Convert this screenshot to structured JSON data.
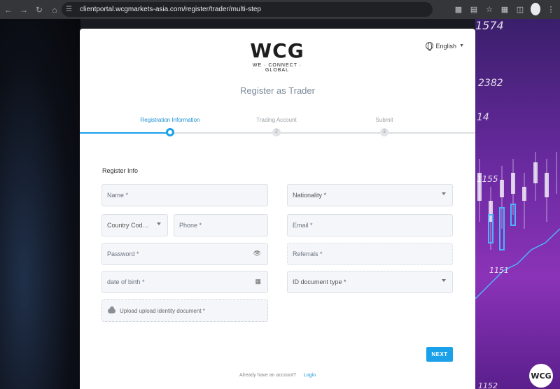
{
  "browser": {
    "url": "clientportal.wcgmarkets-asia.com/register/trader/multi-step"
  },
  "background": {
    "chart_numbers": [
      "1574",
      "2382",
      "14",
      "1155",
      "1151",
      "1152"
    ]
  },
  "brand": {
    "logo_text": "WCG",
    "tagline": "WE · CONNECT · GLOBAL",
    "accent_color": "#d32027",
    "badge_text": "WCG"
  },
  "language": {
    "selected": "English"
  },
  "page_title": "Register as Trader",
  "stepper": {
    "steps": [
      {
        "label": "Registration Information",
        "number": "1"
      },
      {
        "label": "Trading Account",
        "number": "2"
      },
      {
        "label": "Submit",
        "number": "3"
      }
    ],
    "active_index": 0,
    "accent_color": "#1aa1ea"
  },
  "form": {
    "section_title": "Register Info",
    "name_placeholder": "Name *",
    "nationality_placeholder": "Nationality *",
    "country_code_placeholder": "Country Cod…",
    "phone_placeholder": "Phone *",
    "email_placeholder": "Email *",
    "password_placeholder": "Password *",
    "referrals_placeholder": "Referrals *",
    "dob_placeholder": "date of birth *",
    "id_type_placeholder": "ID document type *",
    "upload_label": "Upload  upload identity document *"
  },
  "actions": {
    "next_label": "NEXT"
  },
  "footer": {
    "prompt": "Already have an account?",
    "login_label": "Login"
  }
}
